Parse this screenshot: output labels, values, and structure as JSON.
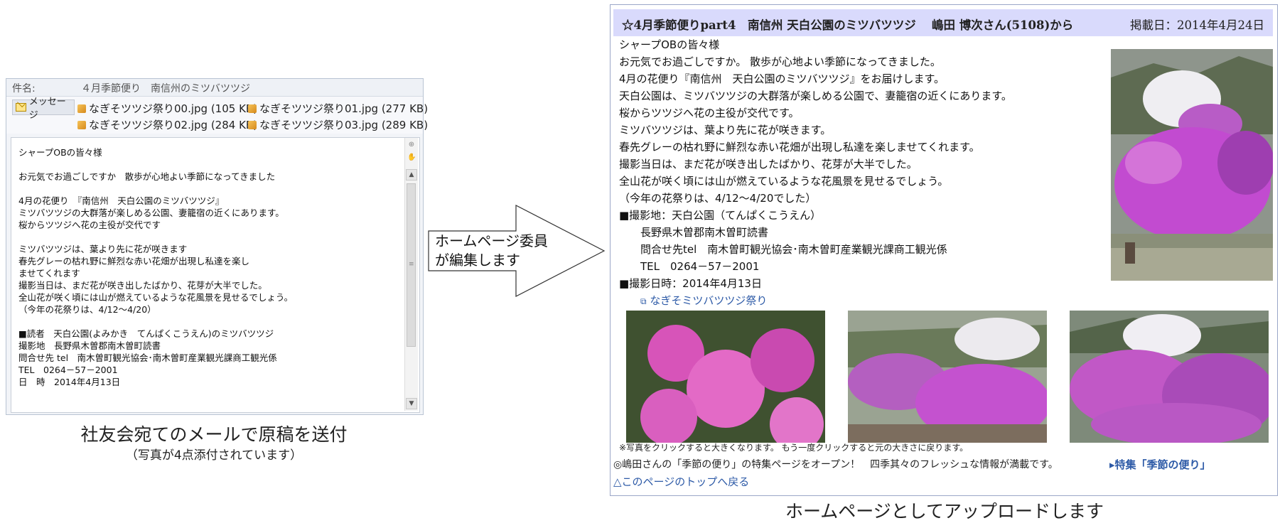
{
  "mail": {
    "subject_label": "件名:",
    "subject_value": "４月季節便り　南信州のミツバツツジ",
    "message_tab": "メッセージ",
    "attachments": [
      "なぎそツツジ祭り00.jpg (105 KB)",
      "なぎそツツジ祭り01.jpg (277 KB)",
      "なぎそツツジ祭り02.jpg (284 KB)",
      "なぎそツツジ祭り03.jpg (289 KB)"
    ],
    "body": "シャープOBの皆々様\n\nお元気でお過ごしですか　散歩が心地よい季節になってきました\n\n4月の花便り　『南信州　天白公園のミツバツツジ』\nミツバツツジの大群落が楽しめる公園、妻籠宿の近くにあります。\n桜からツツジへ花の主役が交代です\n\nミツバツツジは、葉より先に花が咲きます\n春先グレーの枯れ野に鮮烈な赤い花畑が出現し私達を楽し\nませてくれます\n撮影当日は、まだ花が咲き出したばかり、花芽が大半でした。\n全山花が咲く頃には山が燃えているような花風景を見せるでしょう。\n（今年の花祭りは、4/12～4/20）\n\n■読者　天白公園(よみかき　てんぱくこうえん)のミツバツツジ\n撮影地　長野県木曽郡南木曽町読書\n問合せ先 tel　南木曽町観光協会･南木曽町産業観光課商工観光係\nTEL　0264－57－2001\n日　時　2014年4月13日"
  },
  "left_caption": "社友会宛てのメールで原稿を送付",
  "left_subcaption": "（写真が4点添付されています）",
  "arrow_label": [
    "ホームページ委員",
    "が編集します"
  ],
  "web": {
    "title": "☆4月季節便りpart4　南信州 天白公園のミツバツツジ　 嶋田 博次さん(5108)から",
    "date": "掲載日：2014年4月24日",
    "lines": [
      "シャープOBの皆々様",
      "お元気でお過ごしですか。 散歩が心地よい季節になってきました。",
      "4月の花便り『南信州　天白公園のミツバツツジ』をお届けします。",
      "天白公園は、ミツバツツジの大群落が楽しめる公園で、妻籠宿の近くにあります。",
      "桜からツツジへ花の主役が交代です。",
      "ミツバツツジは、葉より先に花が咲きます。",
      "春先グレーの枯れ野に鮮烈な赤い花畑が出現し私達を楽しませてくれます。",
      "撮影当日は、まだ花が咲き出したばかり、花芽が大半でした。",
      "全山花が咲く頃には山が燃えているような花風景を見せるでしょう。",
      "（今年の花祭りは、4/12～4/20でした）",
      "■撮影地：天白公園（てんぱくこうえん）"
    ],
    "indent_lines": [
      "長野県木曽郡南木曽町読書",
      "問合せ先tel　南木曽町観光協会･南木曽町産業観光課商工観光係",
      "TEL　0264－57－2001"
    ],
    "date_line": "■撮影日時：2014年4月13日",
    "festival_link": "なぎそミツバツツジ祭り",
    "note": "※写真をクリックすると大きくなります。 もう一度クリックすると元の大きさに戻ります。",
    "promo": "◎嶋田さんの「季節の便り」の特集ページをオープン！　四季其々のフレッシュな情報が満載です。",
    "special_link": "▸特集「季節の便り」",
    "top_link": "△このページのトップへ戻る"
  },
  "right_caption": "ホームページとしてアップロードします",
  "colors": {
    "header_bg": "#d9dafc",
    "link": "#2d5aa7",
    "azalea": "#c64fcf"
  }
}
